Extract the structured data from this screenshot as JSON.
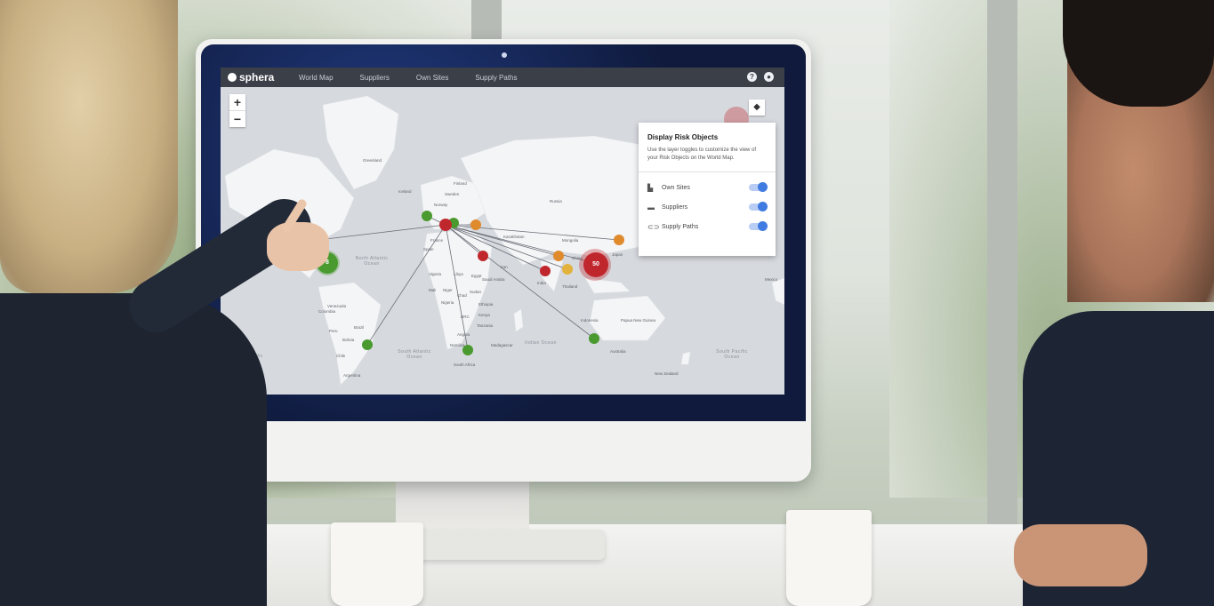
{
  "app": {
    "brand": "sphera",
    "nav": [
      "World Map",
      "Suppliers",
      "Own Sites",
      "Supply Paths"
    ],
    "top_icons": [
      "help-icon",
      "user-icon"
    ]
  },
  "zoom": {
    "in": "+",
    "out": "−"
  },
  "panel": {
    "title": "Display Risk Objects",
    "description": "Use the layer toggles to customize the view of your Risk Objects on the World Map.",
    "toggles": [
      {
        "label": "Own Sites",
        "icon": "factory-icon",
        "on": true
      },
      {
        "label": "Suppliers",
        "icon": "truck-icon",
        "on": true
      },
      {
        "label": "Supply Paths",
        "icon": "link-icon",
        "on": true
      }
    ]
  },
  "clusters": {
    "green": "8",
    "red": "50"
  },
  "map_labels": [
    "Greenland",
    "Iceland",
    "Sweden",
    "Finland",
    "Russia",
    "Norway",
    "Kazakhstan",
    "Mongolia",
    "China",
    "Japan",
    "France",
    "Spain",
    "Iran",
    "India",
    "Thailand",
    "Saudi Arabia",
    "Algeria",
    "Libya",
    "Egypt",
    "Mali",
    "Niger",
    "Sudan",
    "Chad",
    "Nigeria",
    "Ethiopia",
    "DRC",
    "Kenya",
    "Tanzania",
    "Angola",
    "Namibia",
    "Madagascar",
    "South Africa",
    "Venezuela",
    "Colombia",
    "Peru",
    "Brazil",
    "Bolivia",
    "Chile",
    "Argentina",
    "Indonesia",
    "Papua New Guinea",
    "Australia",
    "New Zealand",
    "Mexico"
  ],
  "oceans": [
    "North Atlantic Ocean",
    "South Atlantic Ocean",
    "Indian Ocean",
    "South Pacific Ocean"
  ],
  "colors": {
    "own_site": "#4a9a2f",
    "supplier_high": "#c0272d",
    "supplier_med": "#e08a2e",
    "supplier_low": "#e3b23c",
    "accent": "#3f7be0"
  }
}
